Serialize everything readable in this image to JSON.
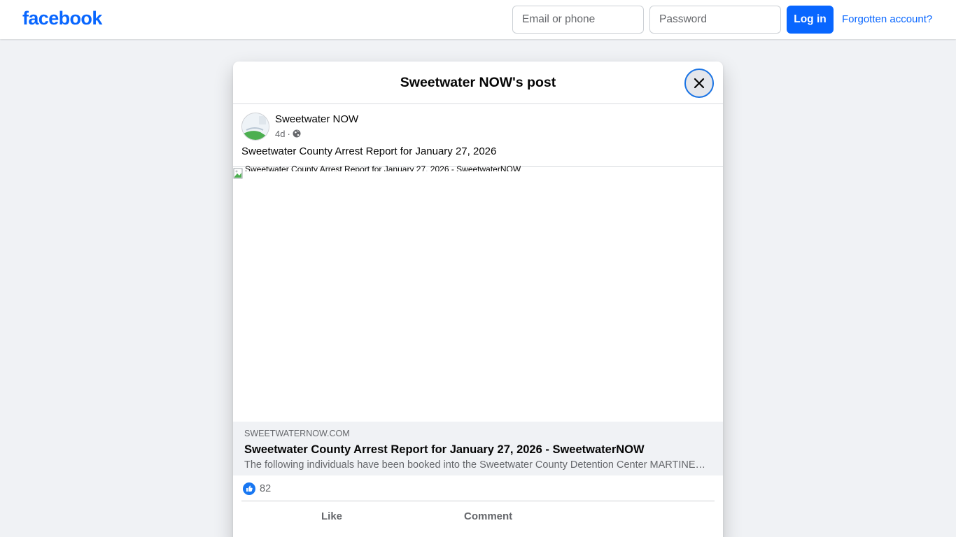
{
  "topbar": {
    "logo": "facebook",
    "email_placeholder": "Email or phone",
    "password_placeholder": "Password",
    "login_label": "Log in",
    "forgot_label": "Forgotten account?"
  },
  "dialog": {
    "title": "Sweetwater NOW's post",
    "close_icon": "close-icon"
  },
  "post": {
    "author": "Sweetwater NOW",
    "time": "4d",
    "separator": "·",
    "audience_icon": "globe-icon",
    "text": "Sweetwater County Arrest Report for January 27, 2026",
    "image_alt": "Sweetwater County Arrest Report for January 27, 2026 - SweetwaterNOW",
    "link": {
      "domain": "SWEETWATERNOW.COM",
      "title": "Sweetwater County Arrest Report for January 27, 2026 - SweetwaterNOW",
      "description": "The following individuals have been booked into the Sweetwater County Detention Center MARTINEZ, JOSE ANTONIO"
    },
    "reactions": {
      "icon": "like-badge-icon",
      "count": "82"
    },
    "actions": {
      "like_label": "Like",
      "comment_label": "Comment"
    }
  },
  "colors": {
    "brand": "#0866ff",
    "page_background": "#f0f2f5",
    "secondary_text": "#65676b"
  }
}
